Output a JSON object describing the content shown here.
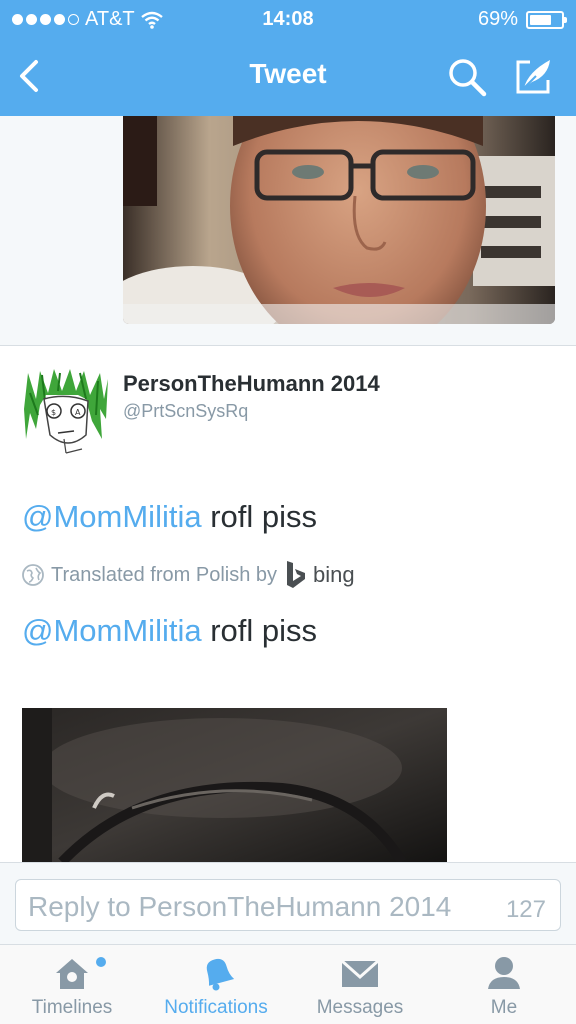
{
  "status_bar": {
    "carrier": "AT&T",
    "time": "14:08",
    "battery_percent": "69%",
    "battery_level": 0.69,
    "signal_bars": 4
  },
  "nav": {
    "title": "Tweet",
    "back_icon": "chevron-left-icon",
    "search_icon": "search-icon",
    "compose_icon": "compose-icon"
  },
  "tweet": {
    "display_name": "PersonTheHumann 2014",
    "handle": "@PrtScnSysRq",
    "text": {
      "mention": "@MomMilitia",
      "body": " rofl piss"
    },
    "translation": {
      "label": "Translated from Polish by",
      "provider": "bing"
    },
    "translated_text": {
      "mention": "@MomMilitia",
      "body": " rofl piss"
    }
  },
  "reply": {
    "placeholder": "Reply to PersonTheHumann 2014",
    "char_count": "127"
  },
  "tabs": [
    {
      "label": "Timelines",
      "icon": "home-icon",
      "active": false,
      "has_badge": true
    },
    {
      "label": "Notifications",
      "icon": "bell-icon",
      "active": true,
      "has_badge": false
    },
    {
      "label": "Messages",
      "icon": "envelope-icon",
      "active": false,
      "has_badge": false
    },
    {
      "label": "Me",
      "icon": "person-icon",
      "active": false,
      "has_badge": false
    }
  ],
  "colors": {
    "brand": "#55acee",
    "text": "#292f33",
    "muted": "#8899a6"
  }
}
